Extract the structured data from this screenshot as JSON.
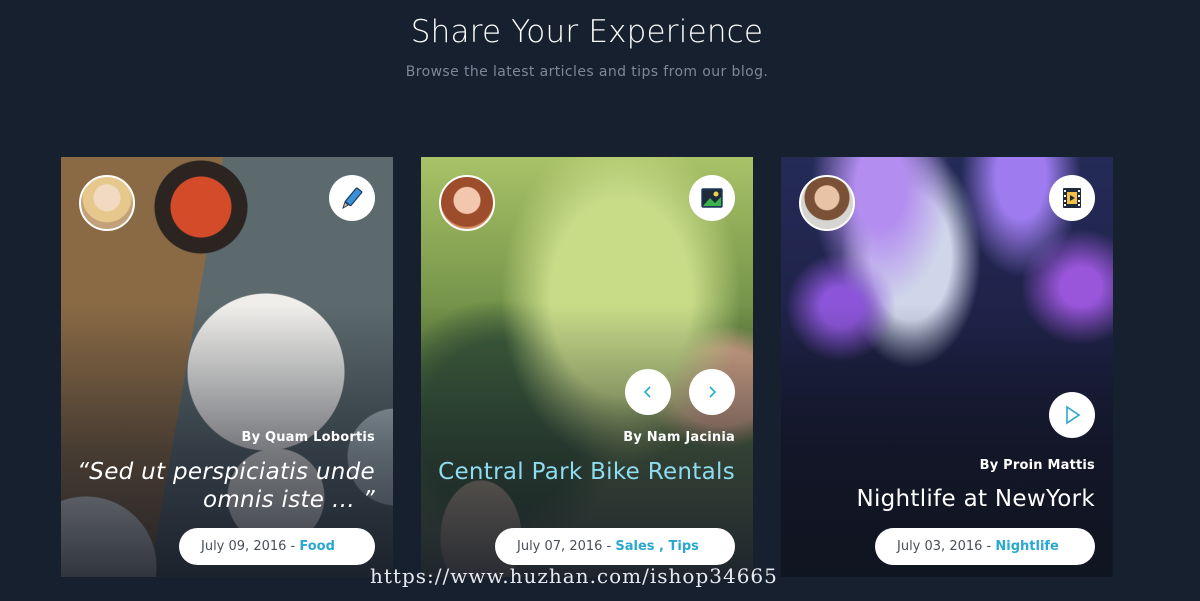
{
  "section": {
    "title": "Share Your Experience",
    "subtitle": "Browse the latest articles and tips from our blog."
  },
  "cards": [
    {
      "author": "By Quam Lobortis",
      "headline": "“Sed ut perspiciatis unde omnis iste … ”",
      "date": "July 09, 2016",
      "separator": " - ",
      "categories": [
        "Food"
      ],
      "type_icon": "pencil-icon"
    },
    {
      "author": "By Nam Jacinia",
      "headline": "Central Park Bike Rentals",
      "date": "July 07, 2016",
      "separator": " - ",
      "categories": [
        "Sales",
        "Tips"
      ],
      "category_joiner": " , ",
      "type_icon": "image-icon"
    },
    {
      "author": "By Proin Mattis",
      "headline": "Nightlife at NewYork",
      "date": "July 03, 2016",
      "separator": " - ",
      "categories": [
        "Nightlife"
      ],
      "type_icon": "film-icon"
    }
  ],
  "watermark": "https://www.huzhan.com/ishop34665",
  "colors": {
    "background": "#17202f",
    "accent": "#2aa8cf",
    "link_headline": "#8edcf0"
  }
}
